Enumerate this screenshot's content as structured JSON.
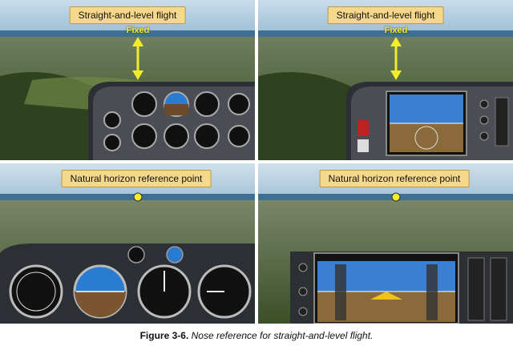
{
  "panels": [
    {
      "label": "Straight-and-level flight",
      "marker_label": "Fixed",
      "marker": "arrow",
      "cockpit": "analog"
    },
    {
      "label": "Straight-and-level flight",
      "marker_label": "Fixed",
      "marker": "arrow",
      "cockpit": "glass"
    },
    {
      "label": "Natural horizon reference point",
      "marker": "dot",
      "cockpit": "analog-closeup"
    },
    {
      "label": "Natural horizon reference point",
      "marker": "dot",
      "cockpit": "glass-closeup"
    }
  ],
  "caption": {
    "figure_number": "Figure 3-6.",
    "text": "Nose reference for straight-and-level flight."
  },
  "colors": {
    "label_bg": "#f6d88a",
    "marker_yellow": "#f2ec2a",
    "sky": "#a9c8dd",
    "sea": "#3f6f93",
    "land": "#4f6236",
    "panel": "#3a3d42"
  },
  "icons": [
    "up-down-arrow-icon",
    "reference-dot-icon"
  ]
}
